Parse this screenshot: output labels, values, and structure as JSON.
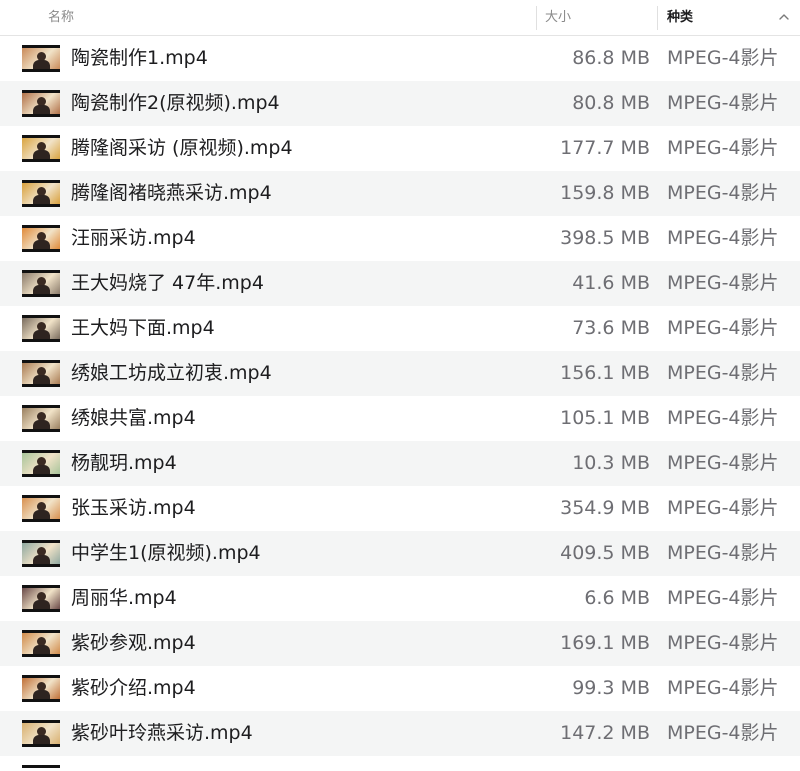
{
  "header": {
    "name_label": "名称",
    "size_label": "大小",
    "kind_label": "种类"
  },
  "files": [
    {
      "name": "陶瓷制作1.mp4",
      "size": "86.8 MB",
      "kind": "MPEG-4影片",
      "thumb": "#c98a5a"
    },
    {
      "name": "陶瓷制作2(原视频).mp4",
      "size": "80.8 MB",
      "kind": "MPEG-4影片",
      "thumb": "#b07048"
    },
    {
      "name": "腾隆阁采访 (原视频).mp4",
      "size": "177.7 MB",
      "kind": "MPEG-4影片",
      "thumb": "#d9a441"
    },
    {
      "name": "腾隆阁褚晓燕采访.mp4",
      "size": "159.8 MB",
      "kind": "MPEG-4影片",
      "thumb": "#d8a03c"
    },
    {
      "name": "汪丽采访.mp4",
      "size": "398.5 MB",
      "kind": "MPEG-4影片",
      "thumb": "#e08a3a"
    },
    {
      "name": "王大妈烧了 47年.mp4",
      "size": "41.6 MB",
      "kind": "MPEG-4影片",
      "thumb": "#8a7a6a"
    },
    {
      "name": "王大妈下面.mp4",
      "size": "73.6 MB",
      "kind": "MPEG-4影片",
      "thumb": "#7a6c5e"
    },
    {
      "name": "绣娘工坊成立初衷.mp4",
      "size": "156.1 MB",
      "kind": "MPEG-4影片",
      "thumb": "#a87a52"
    },
    {
      "name": "绣娘共富.mp4",
      "size": "105.1 MB",
      "kind": "MPEG-4影片",
      "thumb": "#9a8060"
    },
    {
      "name": "杨靓玥.mp4",
      "size": "10.3 MB",
      "kind": "MPEG-4影片",
      "thumb": "#a8c49a"
    },
    {
      "name": "张玉采访.mp4",
      "size": "354.9 MB",
      "kind": "MPEG-4影片",
      "thumb": "#d89050"
    },
    {
      "name": "中学生1(原视频).mp4",
      "size": "409.5 MB",
      "kind": "MPEG-4影片",
      "thumb": "#8fa8a0"
    },
    {
      "name": "周丽华.mp4",
      "size": "6.6 MB",
      "kind": "MPEG-4影片",
      "thumb": "#6a4a48"
    },
    {
      "name": "紫砂参观.mp4",
      "size": "169.1 MB",
      "kind": "MPEG-4影片",
      "thumb": "#d08a4a"
    },
    {
      "name": "紫砂介绍.mp4",
      "size": "99.3 MB",
      "kind": "MPEG-4影片",
      "thumb": "#c07038"
    },
    {
      "name": "紫砂叶玲燕采访.mp4",
      "size": "147.2 MB",
      "kind": "MPEG-4影片",
      "thumb": "#d8b070"
    }
  ],
  "partial_row": {
    "thumb": "#c08850"
  }
}
